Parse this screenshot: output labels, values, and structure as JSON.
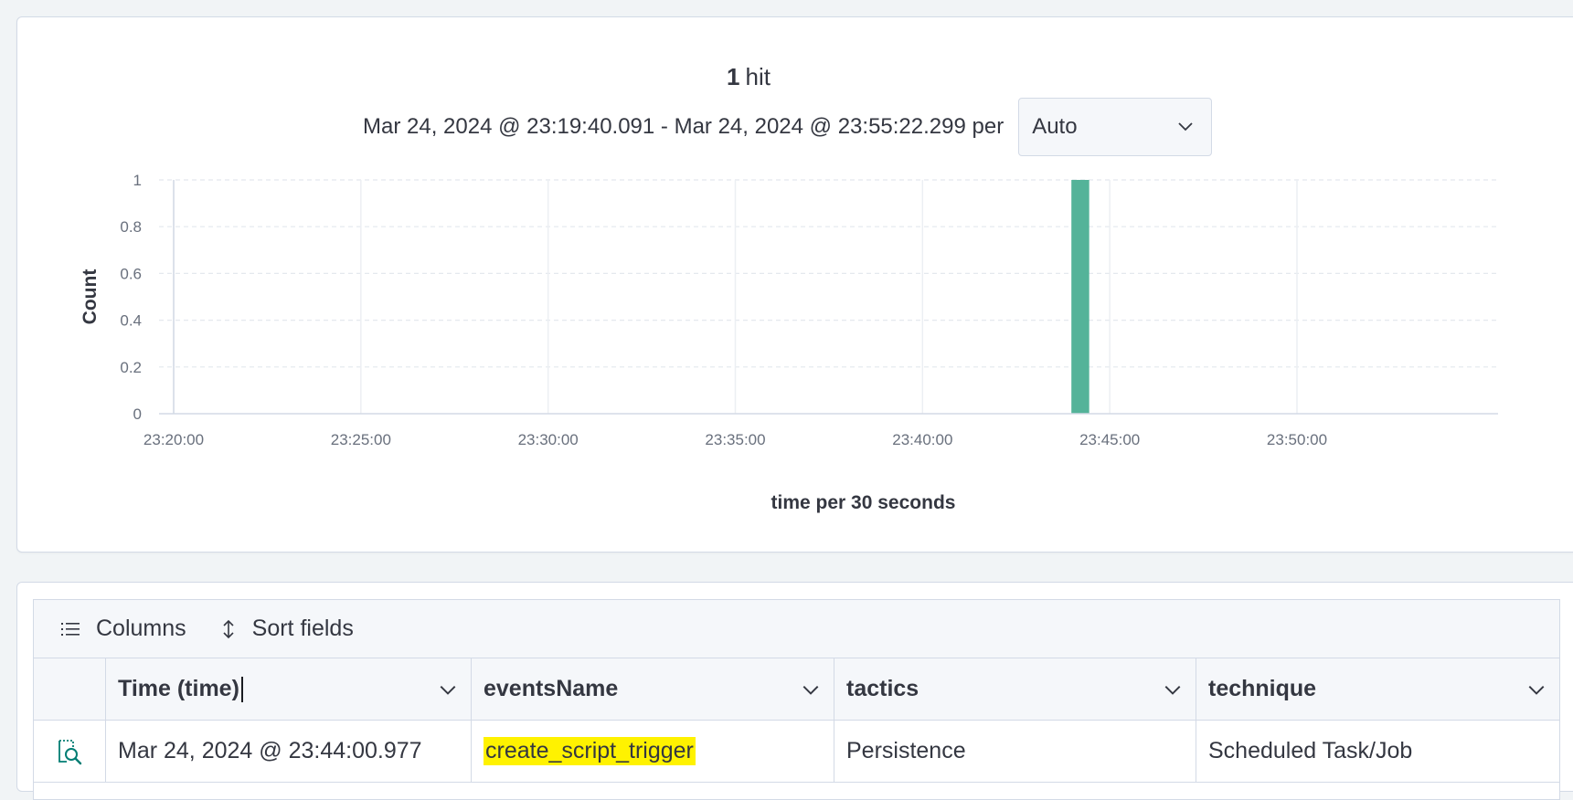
{
  "histogram": {
    "hits_count": "1",
    "hits_label": "hit",
    "time_range_text": "Mar 24, 2024 @ 23:19:40.091 - Mar 24, 2024 @ 23:55:22.299 per",
    "interval_value": "Auto",
    "interval_options_visible": [
      "Auto"
    ],
    "accent_color": "#54b399"
  },
  "chart_data": {
    "type": "bar",
    "title": "",
    "xlabel": "time per 30 seconds",
    "ylabel": "Count",
    "ylim": [
      0,
      1
    ],
    "yticks": [
      "0",
      "0.2",
      "0.4",
      "0.6",
      "0.8",
      "1"
    ],
    "xticks": [
      "23:20:00",
      "23:25:00",
      "23:30:00",
      "23:35:00",
      "23:40:00",
      "23:45:00",
      "23:50:00"
    ],
    "xrange": [
      "23:19:40",
      "23:55:22"
    ],
    "grid": true,
    "series": [
      {
        "x": [
          "23:44:00"
        ],
        "values": [
          1
        ],
        "color": "#54b399"
      }
    ]
  },
  "table": {
    "toolbar": {
      "columns_label": "Columns",
      "sort_label": "Sort fields"
    },
    "headers": [
      "Time (time)",
      "eventsName",
      "tactics",
      "technique"
    ],
    "rows": [
      {
        "time": "Mar 24, 2024 @ 23:44:00.977",
        "eventsName": "create_script_trigger",
        "tactics": "Persistence",
        "technique": "Scheduled Task/Job"
      }
    ],
    "highlight_color": "#fff200"
  }
}
